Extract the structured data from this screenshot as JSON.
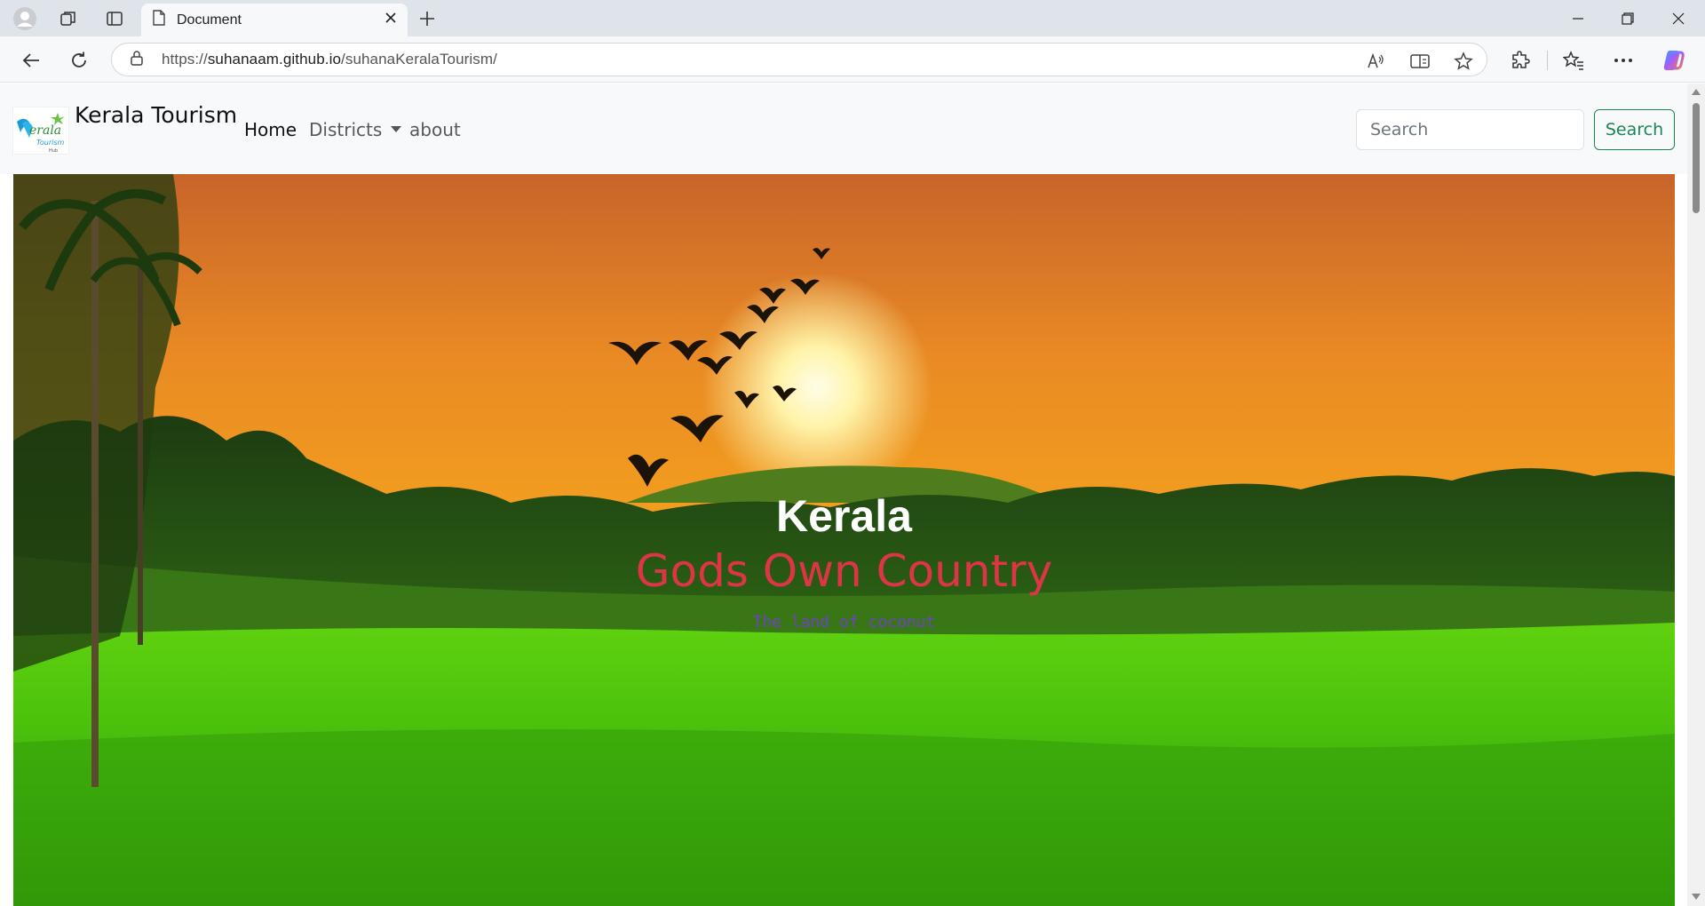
{
  "browser": {
    "tab_title": "Document",
    "url_prefix": "https://",
    "url_host": "suhanaam.github.io",
    "url_path": "/suhanaKeralaTourism/"
  },
  "navbar": {
    "brand": "Kerala Tourism",
    "links": [
      {
        "label": "Home",
        "active": true
      },
      {
        "label": "Districts",
        "dropdown": true
      },
      {
        "label": "about"
      }
    ],
    "search_placeholder": "Search",
    "search_button": "Search"
  },
  "hero": {
    "title": "Kerala",
    "subtitle": "Gods Own Country",
    "tagline": "The land of coconut"
  },
  "colors": {
    "subtitle": "#dc3545",
    "tagline": "#6f42c1",
    "search_button": "#198754"
  }
}
